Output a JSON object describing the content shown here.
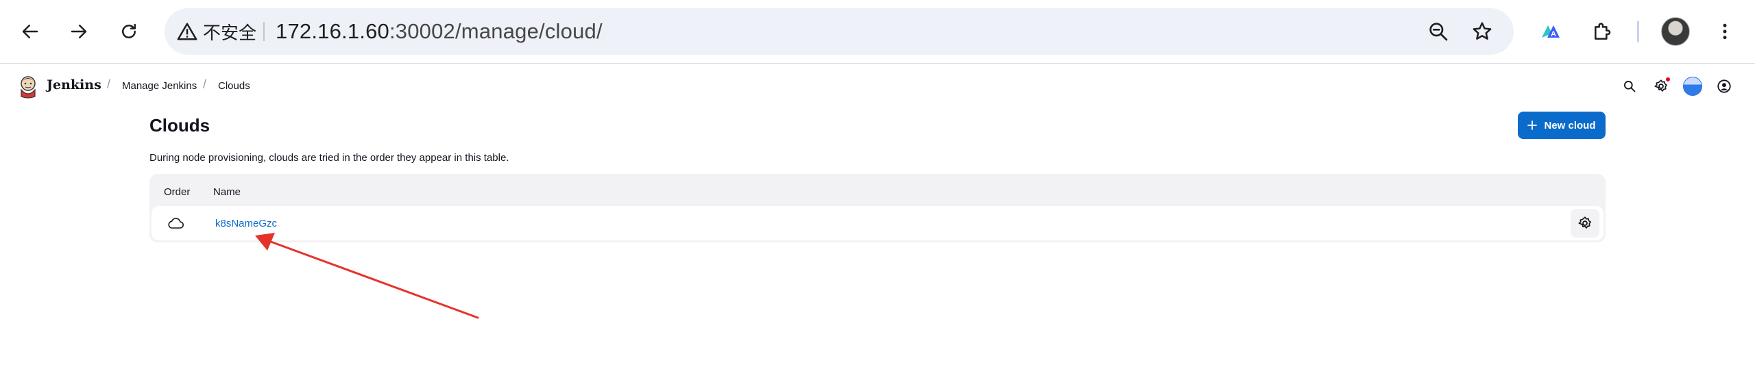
{
  "browser": {
    "security_label": "不安全",
    "url_host": "172.16.1.60",
    "url_path": ":30002/manage/cloud/",
    "icons": [
      "back-icon",
      "forward-icon",
      "reload-icon",
      "warning-icon",
      "zoom-icon",
      "star-icon",
      "extension-translate-icon",
      "extensions-icon",
      "profile-avatar",
      "more-icon"
    ]
  },
  "header": {
    "brand": "Jenkins",
    "breadcrumbs": [
      "Manage Jenkins",
      "Clouds"
    ],
    "separator": "/",
    "icons": [
      "search-icon",
      "settings-icon",
      "weather-icon",
      "user-icon"
    ]
  },
  "page": {
    "title": "Clouds",
    "new_button_label": "New cloud",
    "description": "During node provisioning, clouds are tried in the order they appear in this table.",
    "table": {
      "columns": [
        "Order",
        "Name"
      ],
      "rows": [
        {
          "name": "k8sNameGzc",
          "icon": "cloud-icon",
          "action_icon": "gear-icon"
        }
      ]
    }
  },
  "colors": {
    "accent": "#0b6bcb",
    "annotation_arrow": "#e5332a",
    "notification_dot": "#e6001f"
  }
}
